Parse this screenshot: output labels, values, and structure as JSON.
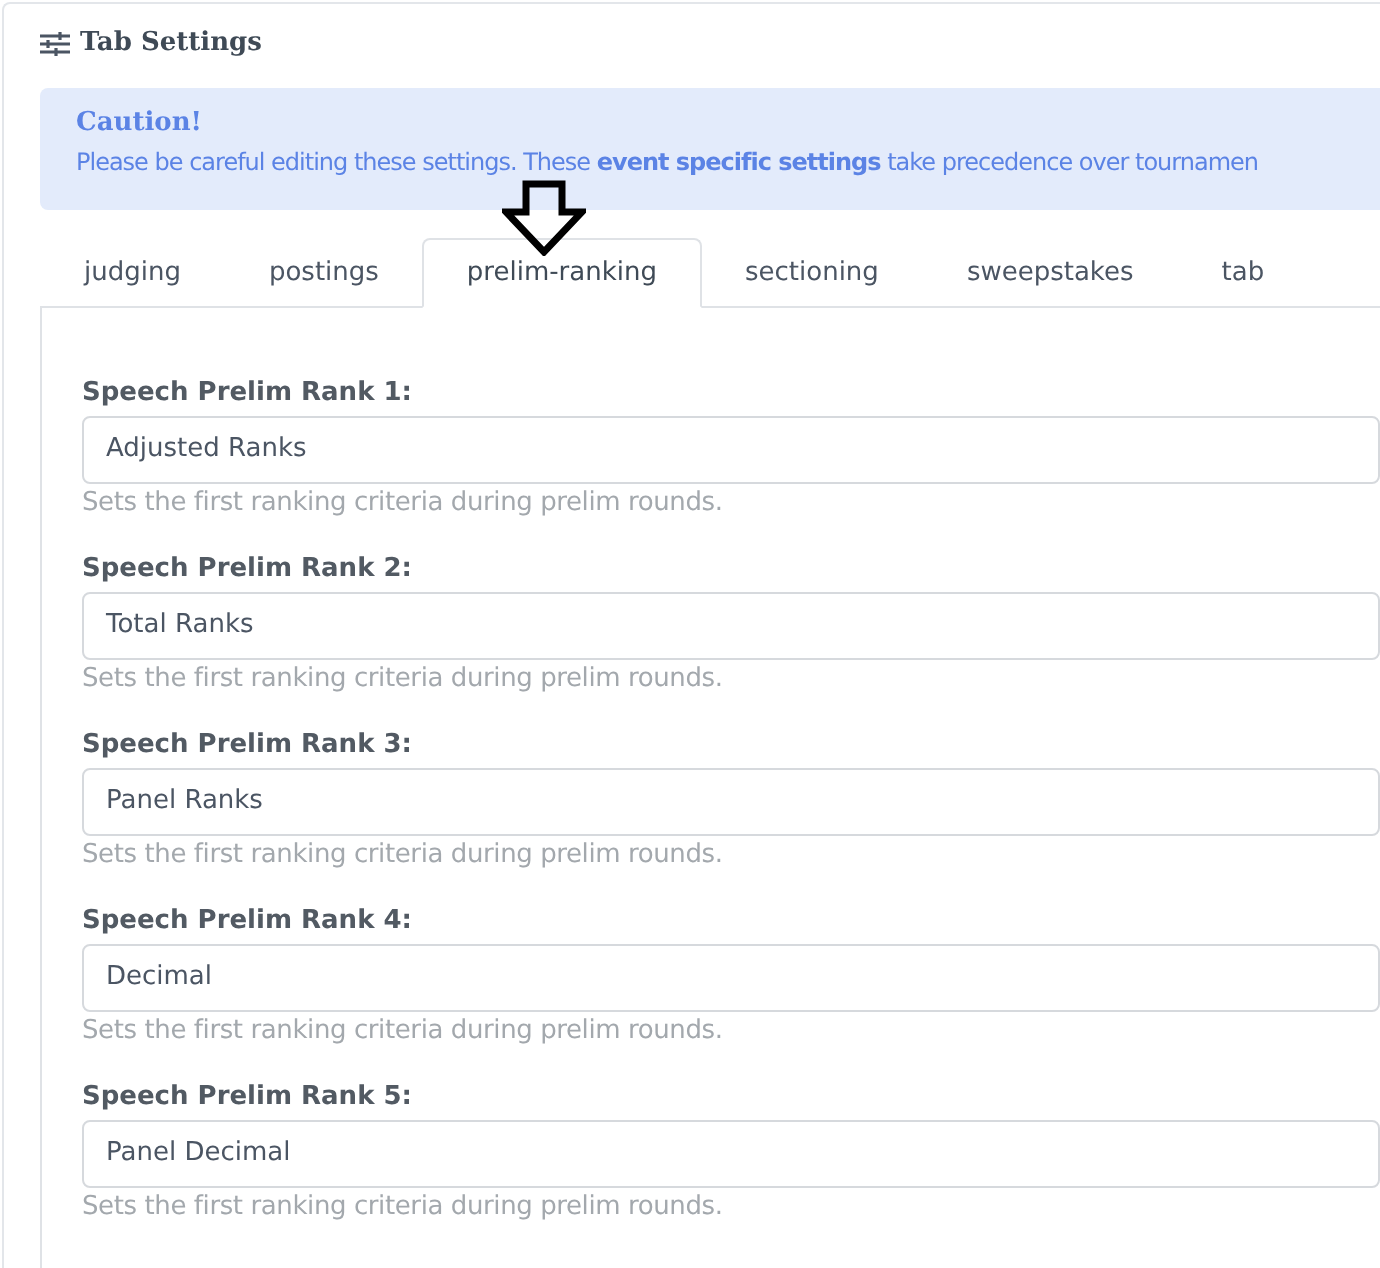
{
  "card": {
    "title": "Tab Settings"
  },
  "alert": {
    "heading": "Caution!",
    "text": "Please be careful editing these settings. These **event specific settings** take precedence over tournamen"
  },
  "tabs": [
    {
      "label": "judging",
      "selected": false
    },
    {
      "label": "postings",
      "selected": false
    },
    {
      "label": "prelim-ranking",
      "selected": true
    },
    {
      "label": "sectioning",
      "selected": false
    },
    {
      "label": "sweepstakes",
      "selected": false
    },
    {
      "label": "tab",
      "selected": false
    }
  ],
  "fields": [
    {
      "label": "Speech Prelim Rank 1:",
      "value": "Adjusted Ranks",
      "help": "Sets the first ranking criteria during prelim rounds."
    },
    {
      "label": "Speech Prelim Rank 2:",
      "value": "Total Ranks",
      "help": "Sets the first ranking criteria during prelim rounds."
    },
    {
      "label": "Speech Prelim Rank 3:",
      "value": "Panel Ranks",
      "help": "Sets the first ranking criteria during prelim rounds."
    },
    {
      "label": "Speech Prelim Rank 4:",
      "value": "Decimal",
      "help": "Sets the first ranking criteria during prelim rounds."
    },
    {
      "label": "Speech Prelim Rank 5:",
      "value": "Panel Decimal",
      "help": "Sets the first ranking criteria during prelim rounds."
    }
  ]
}
